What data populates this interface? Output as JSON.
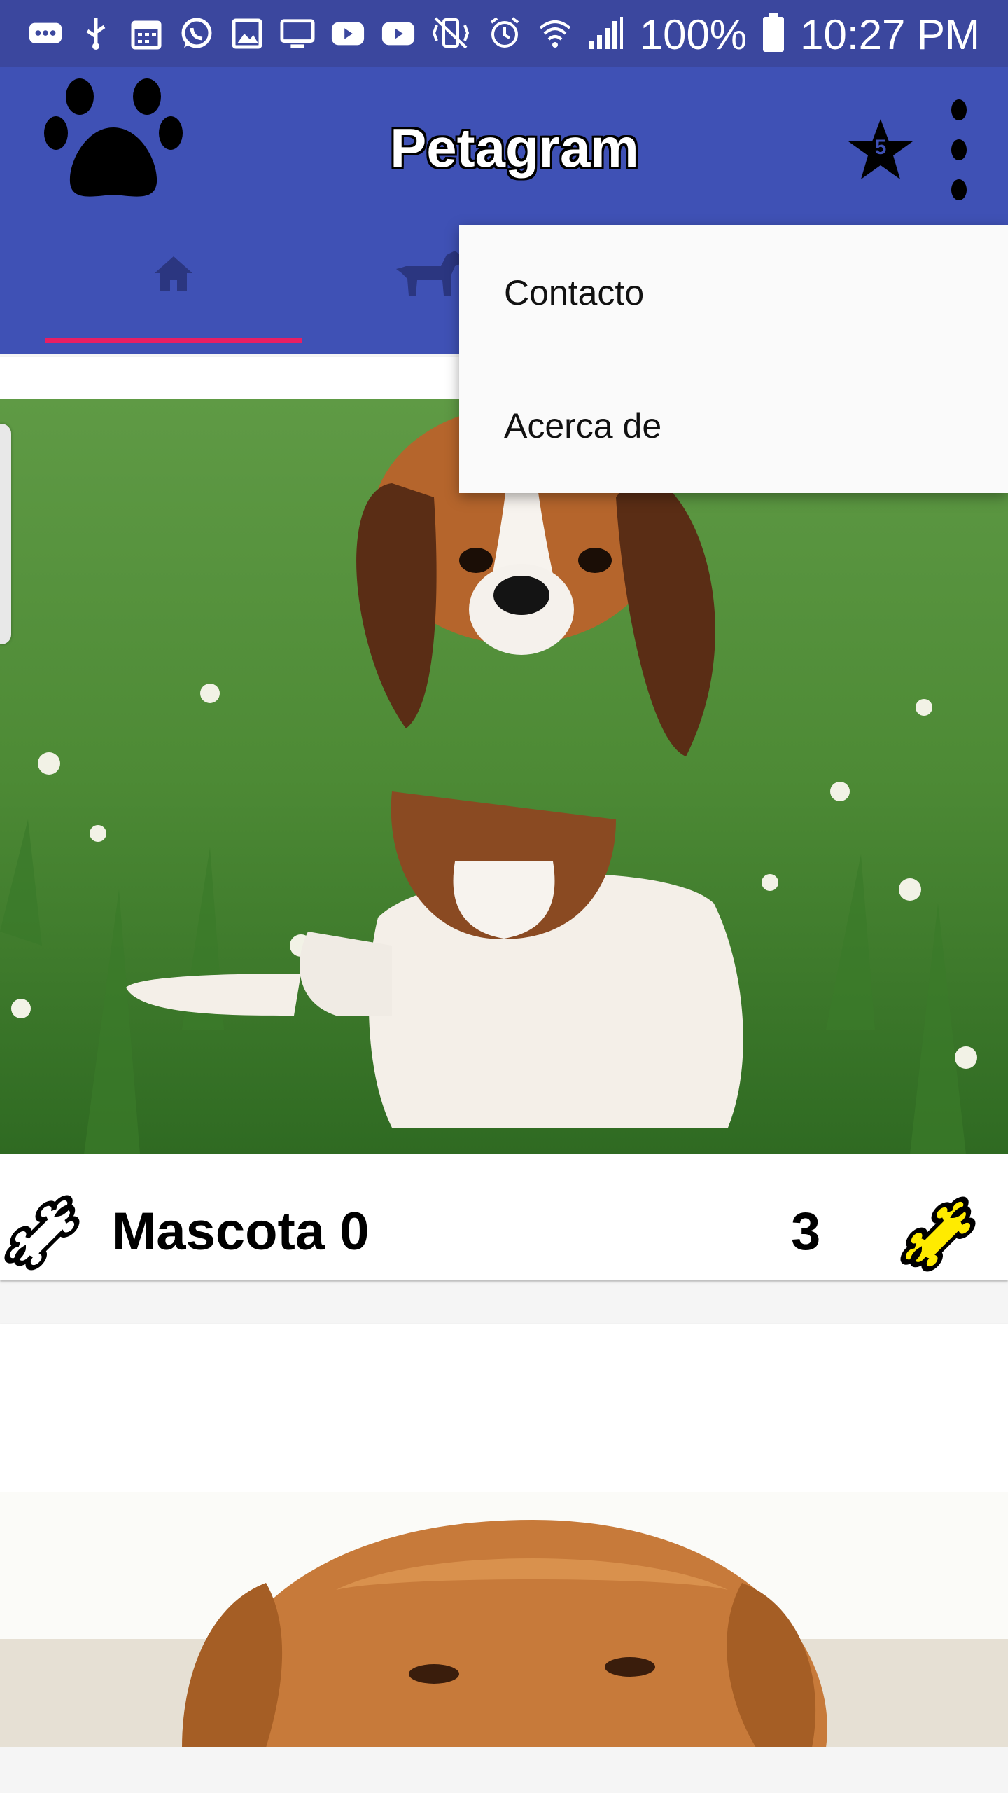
{
  "status_bar": {
    "battery_text": "100%",
    "time": "10:27 PM",
    "icons": [
      "messages-icon",
      "usb-icon",
      "calendar-icon",
      "whatsapp-icon",
      "gallery-icon",
      "screen-cast-icon",
      "youtube-icon",
      "youtube-icon",
      "vibrate-mute-icon",
      "alarm-icon",
      "wifi-icon",
      "signal-icon",
      "battery-icon"
    ]
  },
  "app_bar": {
    "title": "Petagram",
    "favorites_badge": "5",
    "accent_color": "#3f51b5",
    "indicator_color": "#e91e63"
  },
  "tabs": [
    {
      "icon": "home-icon",
      "selected": true
    },
    {
      "icon": "dog-icon",
      "selected": false
    }
  ],
  "overflow_menu": {
    "items": [
      {
        "label": "Contacto"
      },
      {
        "label": "Acerca de"
      }
    ]
  },
  "pets": [
    {
      "name": "Mascota 0",
      "likes": "3",
      "photo": "beagle puppy in grass"
    },
    {
      "photo": "golden retriever"
    }
  ]
}
